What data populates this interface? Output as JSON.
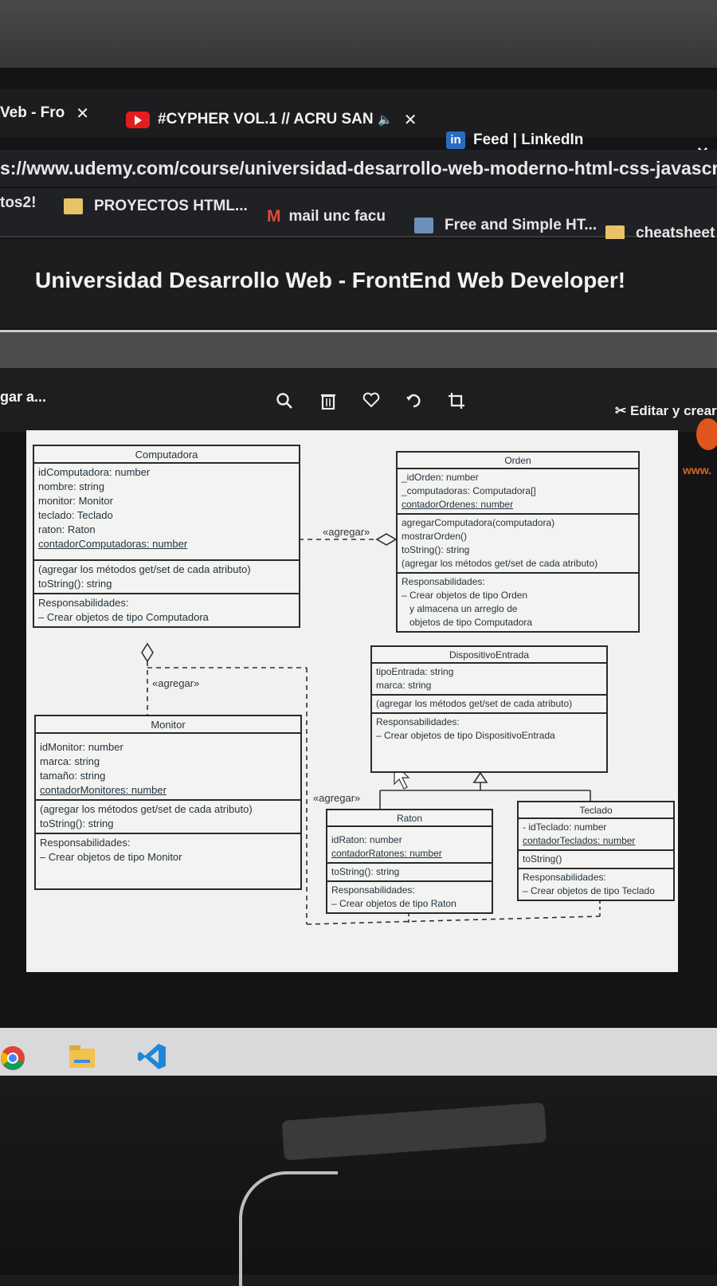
{
  "tabs": [
    {
      "label": "Veb - Fro",
      "close": "✕"
    },
    {
      "label": "#CYPHER VOL.1 // ACRU SAN",
      "close": "✕"
    },
    {
      "label": "Feed | LinkedIn"
    }
  ],
  "window_close": "✕",
  "url": "s://www.udemy.com/course/universidad-desarrollo-web-moderno-html-css-javascript-htm",
  "bookmarks": [
    {
      "label": "tos2!"
    },
    {
      "label": "PROYECTOS HTML..."
    },
    {
      "label": "mail unc facu"
    },
    {
      "label": "Free and Simple HT..."
    },
    {
      "label": "cheatsheet pa"
    }
  ],
  "course_title": "Universidad Desarrollo Web - FrontEnd Web Developer!",
  "viewer": {
    "left_text": "gar a...",
    "edit_button": "Editar y crear",
    "watermark": "www.",
    "tools": [
      "search-icon",
      "trash-icon",
      "heart-icon",
      "rotate-icon",
      "crop-icon"
    ]
  },
  "uml": {
    "computadora": {
      "name": "Computadora",
      "attributes": [
        "idComputadora: number",
        "nombre: string",
        "monitor: Monitor",
        "teclado: Teclado",
        "raton: Raton",
        "contadorComputadoras: number"
      ],
      "methods": [
        "(agregar los métodos get/set de cada atributo)",
        "toString(): string"
      ],
      "responsibilities": [
        "Responsabilidades:",
        "– Crear objetos de tipo Computadora"
      ]
    },
    "orden": {
      "name": "Orden",
      "attributes": [
        "_idOrden: number",
        "_computadoras: Computadora[]",
        "contadorOrdenes: number"
      ],
      "methods": [
        "agregarComputadora(computadora)",
        "mostrarOrden()",
        "toString(): string",
        "(agregar los métodos get/set de cada atributo)"
      ],
      "responsibilities": [
        "Responsabilidades:",
        "– Crear objetos de tipo Orden",
        "y almacena un arreglo de",
        "objetos de tipo Computadora"
      ]
    },
    "monitor": {
      "name": "Monitor",
      "attributes": [
        "idMonitor: number",
        "marca: string",
        "tamaño: string",
        "contadorMonitores: number"
      ],
      "methods": [
        "(agregar los métodos get/set de cada atributo)",
        "toString(): string"
      ],
      "responsibilities": [
        "Responsabilidades:",
        "– Crear objetos de tipo Monitor"
      ]
    },
    "dispositivo": {
      "name": "DispositivoEntrada",
      "attributes": [
        "tipoEntrada: string",
        "marca: string"
      ],
      "methods": [
        "(agregar los métodos get/set de cada atributo)"
      ],
      "responsibilities": [
        "Responsabilidades:",
        "– Crear objetos de tipo DispositivoEntrada"
      ]
    },
    "raton": {
      "name": "Raton",
      "attributes": [
        "idRaton: number",
        "contadorRatones: number"
      ],
      "methods": [
        "toString(): string"
      ],
      "responsibilities": [
        "Responsabilidades:",
        "– Crear objetos de tipo Raton"
      ]
    },
    "teclado": {
      "name": "Teclado",
      "attributes": [
        "- idTeclado: number",
        "contadorTeclados: number"
      ],
      "methods": [
        "toString()"
      ],
      "responsibilities": [
        "Responsabilidades:",
        "– Crear objetos de tipo Teclado"
      ]
    },
    "stereotypes": [
      "«agregar»",
      "«agregar»",
      "«agregar»"
    ]
  }
}
